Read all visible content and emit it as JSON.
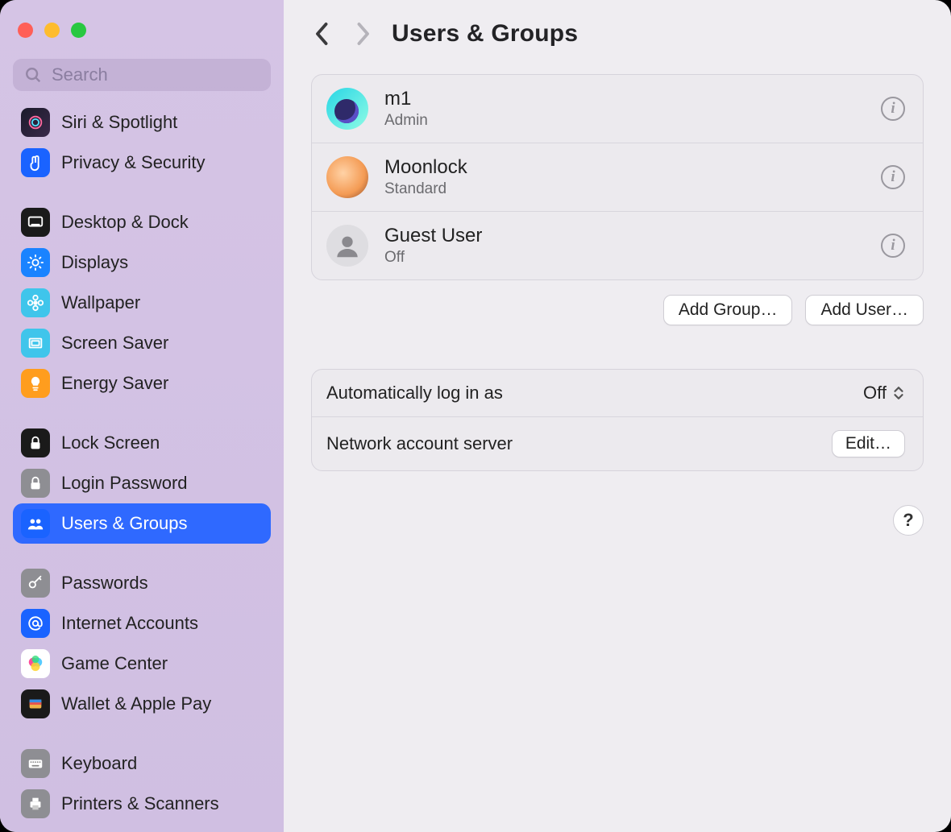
{
  "window": {
    "title": "Users & Groups"
  },
  "search": {
    "placeholder": "Search"
  },
  "sidebar": {
    "items": [
      {
        "id": "siri-spotlight",
        "label": "Siri & Spotlight",
        "icon_bg": "linear-gradient(135deg,#1a1a2a,#3a2a4a)",
        "glyph": "siri"
      },
      {
        "id": "privacy-security",
        "label": "Privacy & Security",
        "icon_bg": "#1a63ff",
        "glyph": "hand"
      },
      {
        "gap": true
      },
      {
        "id": "desktop-dock",
        "label": "Desktop & Dock",
        "icon_bg": "#1a1a1a",
        "glyph": "dock"
      },
      {
        "id": "displays",
        "label": "Displays",
        "icon_bg": "#1a83ff",
        "glyph": "sun"
      },
      {
        "id": "wallpaper",
        "label": "Wallpaper",
        "icon_bg": "#3fc5eb",
        "glyph": "flower"
      },
      {
        "id": "screen-saver",
        "label": "Screen Saver",
        "icon_bg": "#3fc5eb",
        "glyph": "frame"
      },
      {
        "id": "energy-saver",
        "label": "Energy Saver",
        "icon_bg": "#ff9d1e",
        "glyph": "bulb"
      },
      {
        "gap": true
      },
      {
        "id": "lock-screen",
        "label": "Lock Screen",
        "icon_bg": "#1a1a1a",
        "glyph": "lock"
      },
      {
        "id": "login-password",
        "label": "Login Password",
        "icon_bg": "#8e8e93",
        "glyph": "lock"
      },
      {
        "id": "users-groups",
        "label": "Users & Groups",
        "icon_bg": "#1a63ff",
        "glyph": "people",
        "selected": true
      },
      {
        "gap": true
      },
      {
        "id": "passwords",
        "label": "Passwords",
        "icon_bg": "#8e8e93",
        "glyph": "key"
      },
      {
        "id": "internet-accounts",
        "label": "Internet Accounts",
        "icon_bg": "#1a63ff",
        "glyph": "at"
      },
      {
        "id": "game-center",
        "label": "Game Center",
        "icon_bg": "#ffffff",
        "glyph": "gamecenter"
      },
      {
        "id": "wallet-apple-pay",
        "label": "Wallet & Apple Pay",
        "icon_bg": "#1a1a1a",
        "glyph": "wallet"
      },
      {
        "gap": true
      },
      {
        "id": "keyboard",
        "label": "Keyboard",
        "icon_bg": "#8e8e93",
        "glyph": "keyboard"
      },
      {
        "id": "printers-scanners",
        "label": "Printers & Scanners",
        "icon_bg": "#8e8e93",
        "glyph": "printer"
      }
    ]
  },
  "users": [
    {
      "id": "m1",
      "name": "m1",
      "role": "Admin",
      "avatar": "m1"
    },
    {
      "id": "moonlock",
      "name": "Moonlock",
      "role": "Standard",
      "avatar": "moonlock"
    },
    {
      "id": "guest",
      "name": "Guest User",
      "role": "Off",
      "avatar": "guest"
    }
  ],
  "buttons": {
    "add_group": "Add Group…",
    "add_user": "Add User…",
    "edit": "Edit…",
    "help": "?"
  },
  "settings": {
    "auto_login_label": "Automatically log in as",
    "auto_login_value": "Off",
    "network_server_label": "Network account server"
  }
}
